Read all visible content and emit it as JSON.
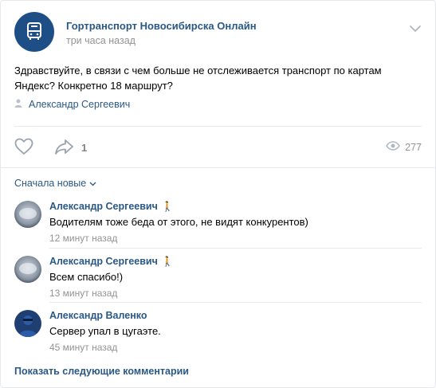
{
  "post": {
    "group_name": "Гортранспорт Новосибирска Онлайн",
    "time": "три часа назад",
    "text": "Здравствуйте, в связи с чем больше не отслеживается транспорт по картам Яндекс? Конкретно 18 маршрут?",
    "signer": "Александр Сергеевич",
    "share_count": "1",
    "views_count": "277",
    "icons": {
      "group_avatar": "bus-icon",
      "menu": "chevron-down-icon",
      "signer": "user-icon",
      "like": "heart-icon",
      "share": "share-arrow-icon",
      "views": "eye-icon"
    }
  },
  "comments_section": {
    "sort_label": "Сначала новые",
    "comments": [
      {
        "author": "Александр Сергеевич",
        "badge": "🚶",
        "text": "Водителям тоже беда от этого, не видят конкурентов)",
        "time": "12 минут назад"
      },
      {
        "author": "Александр Сергеевич",
        "badge": "🚶",
        "text": "Всем спасибо!)",
        "time": "13 минут назад"
      },
      {
        "author": "Александр Валенко",
        "badge": "",
        "text": "Сервер упал в цугаэте.",
        "time": "45 минут назад"
      }
    ],
    "show_more_label": "Показать следующие комментарии"
  },
  "colors": {
    "link": "#2a5885",
    "meta": "#939393",
    "divider": "#e7e8ec",
    "group_avatar": "#1d4f86"
  }
}
